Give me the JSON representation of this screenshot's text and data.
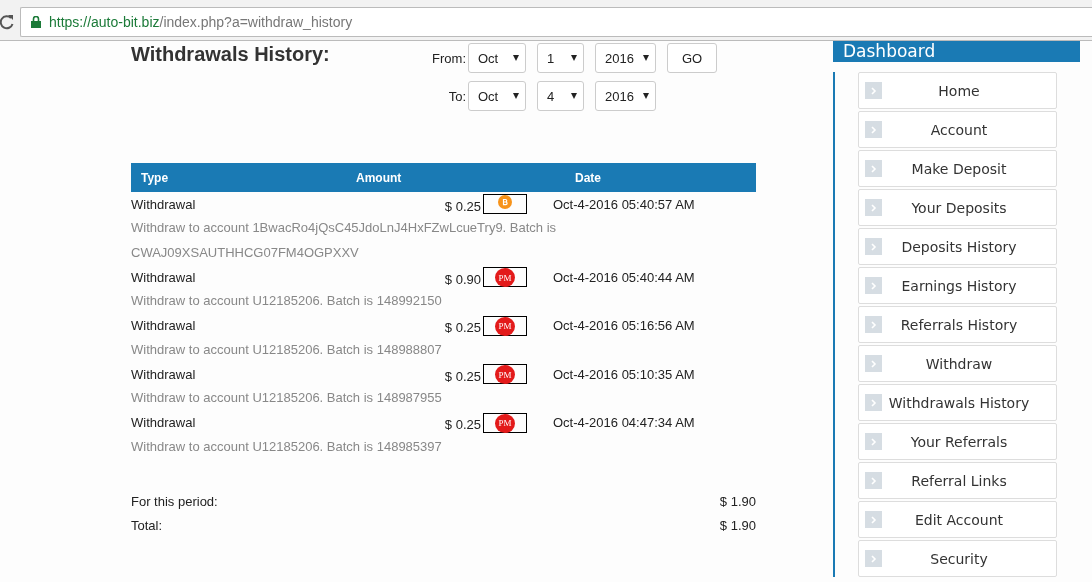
{
  "browser": {
    "url_host": "https://auto-bit.biz",
    "url_path": "/index.php?a=withdraw_history"
  },
  "page": {
    "title": "Withdrawals History:",
    "filter": {
      "from_label": "From:",
      "from": [
        "Oct",
        "1",
        "2016"
      ],
      "go": "GO",
      "to_label": "To:",
      "to": [
        "Oct",
        "4",
        "2016"
      ]
    },
    "table": {
      "columns": [
        "Type",
        "Amount",
        "Date"
      ],
      "rows": [
        {
          "type": "Withdrawal",
          "amount": "$ 0.25",
          "method": {
            "kind": "bitcoin"
          },
          "date": "Oct-4-2016 05:40:57 AM",
          "note": "Withdraw to account 1BwacRo4jQsC45JdoLnJ4HxFZwLcueTry9. Batch is CWAJ09XSAUTHHCG07FM4OGPXXV"
        },
        {
          "type": "Withdrawal",
          "amount": "$ 0.90",
          "method": {
            "kind": "pm",
            "label": "PM"
          },
          "date": "Oct-4-2016 05:40:44 AM",
          "note": "Withdraw to account U12185206. Batch is 148992150"
        },
        {
          "type": "Withdrawal",
          "amount": "$ 0.25",
          "method": {
            "kind": "pm",
            "label": "PM"
          },
          "date": "Oct-4-2016 05:16:56 AM",
          "note": "Withdraw to account U12185206. Batch is 148988807"
        },
        {
          "type": "Withdrawal",
          "amount": "$ 0.25",
          "method": {
            "kind": "pm",
            "label": "PM"
          },
          "date": "Oct-4-2016 05:10:35 AM",
          "note": "Withdraw to account U12185206. Batch is 148987955"
        },
        {
          "type": "Withdrawal",
          "amount": "$ 0.25",
          "method": {
            "kind": "pm",
            "label": "PM"
          },
          "date": "Oct-4-2016 04:47:34 AM",
          "note": "Withdraw to account U12185206. Batch is 148985397"
        }
      ]
    },
    "totals": [
      {
        "label": "For this period:",
        "value": "$ 1.90"
      },
      {
        "label": "Total:",
        "value": "$ 1.90"
      }
    ]
  },
  "sidebar": {
    "title": "Dashboard",
    "items": [
      "Home",
      "Account",
      "Make Deposit",
      "Your Deposits",
      "Deposits History",
      "Earnings History",
      "Referrals History",
      "Withdraw",
      "Withdrawals History",
      "Your Referrals",
      "Referral Links",
      "Edit Account",
      "Security"
    ]
  }
}
